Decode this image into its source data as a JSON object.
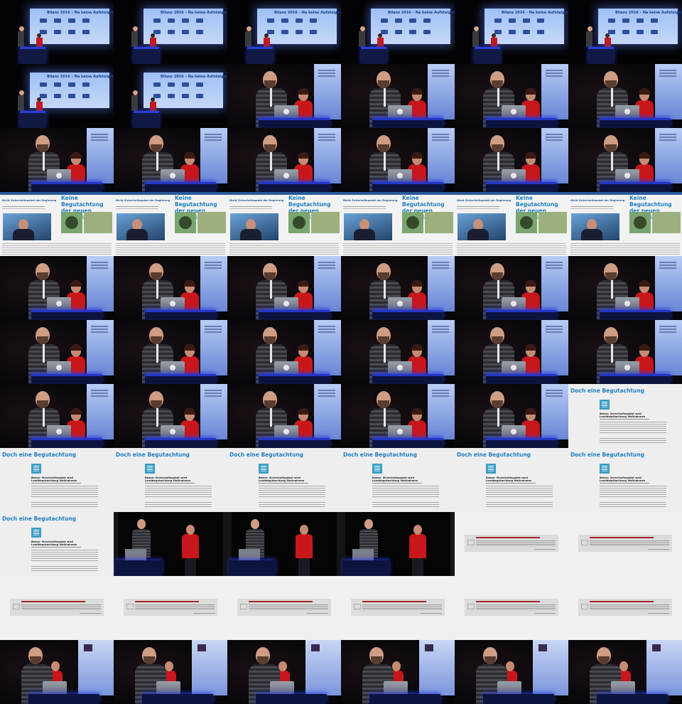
{
  "contact_sheet": {
    "columns": 6,
    "rows": 11,
    "frames": [
      "stage-wide",
      "stage-wide",
      "stage-wide",
      "stage-wide",
      "stage-wide",
      "stage-wide",
      "stage-wide",
      "stage-wide",
      "medium",
      "medium",
      "medium",
      "medium",
      "medium",
      "medium",
      "medium",
      "medium",
      "medium",
      "medium",
      "article-slide",
      "article-slide",
      "article-slide",
      "article-slide",
      "article-slide",
      "article-slide",
      "medium",
      "medium",
      "medium",
      "medium",
      "medium",
      "medium",
      "medium",
      "medium",
      "medium",
      "medium",
      "medium",
      "medium",
      "medium",
      "medium",
      "medium",
      "medium",
      "medium",
      "doch-slide",
      "doch-slide",
      "doch-slide",
      "doch-slide",
      "doch-slide",
      "doch-slide",
      "doch-slide",
      "doch-slide",
      "stage-dark",
      "stage-dark",
      "stage-dark",
      "quote-slide",
      "quote-slide",
      "quote-slide",
      "quote-slide",
      "quote-slide",
      "quote-slide",
      "quote-slide",
      "quote-slide",
      "medium-logo",
      "medium-logo",
      "medium-logo",
      "medium-logo",
      "medium-logo",
      "medium-logo"
    ]
  },
  "slides": {
    "stage_screen_title": "Bilanz 2016 – Na keine Aufsteiger",
    "article_headline": "Keine Begutachtung der neuen Vorschläge…",
    "article_kicker": "Nicht Sicherheitspaket der Regierung",
    "doch_title": "Doch eine Begutachtung",
    "doch_heading": "Bezos: Sicherheitspaket wird Landbegutachtung Maßnahmen"
  },
  "colors": {
    "slide_blue": "#1f7fbf",
    "shirt_red": "#c8171c",
    "stage_blue": "#2436c8"
  }
}
